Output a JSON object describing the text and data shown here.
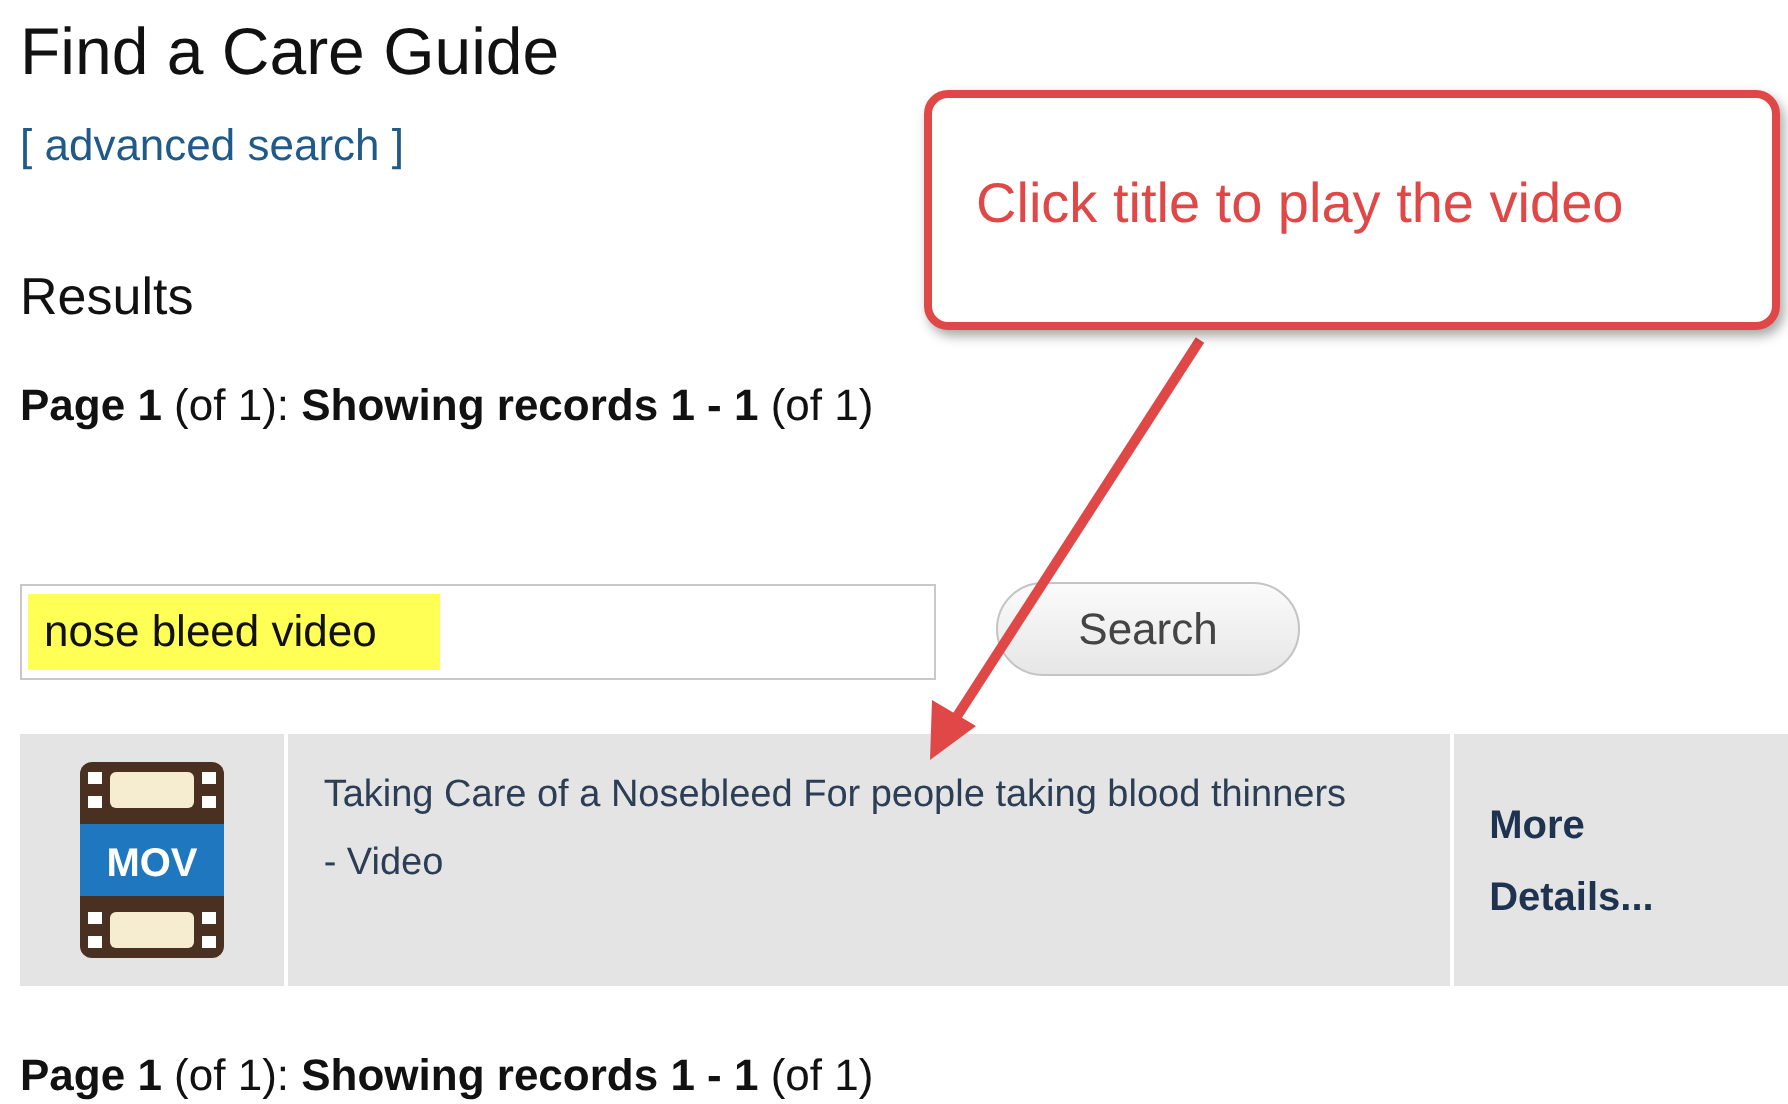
{
  "heading": "Find a Care Guide",
  "advanced_link": "[ advanced search ]",
  "results_heading": "Results",
  "pagination_top": "**Page 1** (of 1): **Showing records 1 - 1** (of 1)",
  "search": {
    "value": "nose bleed video",
    "button": "Search"
  },
  "results": [
    {
      "file_type": "MOV",
      "title": "Taking Care of a Nosebleed For people taking blood thinners - Video",
      "details": "More Details..."
    }
  ],
  "pagination_bottom": "**Page 1** (of 1): **Showing records 1 - 1** (of 1)",
  "callout": {
    "text": "Click title to play the video"
  }
}
